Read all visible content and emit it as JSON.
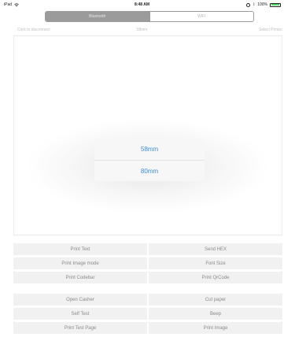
{
  "status_bar": {
    "device": "iPad",
    "time": "8:48 AM",
    "battery": "100%",
    "wifi_icon": "wifi-icon",
    "bluetooth_icon": "bluetooth-icon",
    "battery_icon": "battery-icon"
  },
  "segmented_control": {
    "options": [
      "Bluetooth",
      "WIFI"
    ],
    "selected": "Bluetooth"
  },
  "info_row": {
    "connection_hint": "Click to disconnect",
    "paper_size": "58mm",
    "select_printer": "Select Printer"
  },
  "paper_popover": {
    "options": [
      "58mm",
      "80mm"
    ]
  },
  "buttons_group1": [
    "Print Text",
    "Send HEX",
    "Print Image mode",
    "Font Size",
    "Print Codebar",
    "Print QrCode"
  ],
  "buttons_group2": [
    "Open Casher",
    "Cut paper",
    "Self Test",
    "Beep",
    "Print Test Page",
    "Print Image"
  ],
  "colors": {
    "accent": "#3d8cd8",
    "segment_selected": "#9b9b9b",
    "button_bg": "#f1f1f1",
    "battery": "#4cd964"
  }
}
